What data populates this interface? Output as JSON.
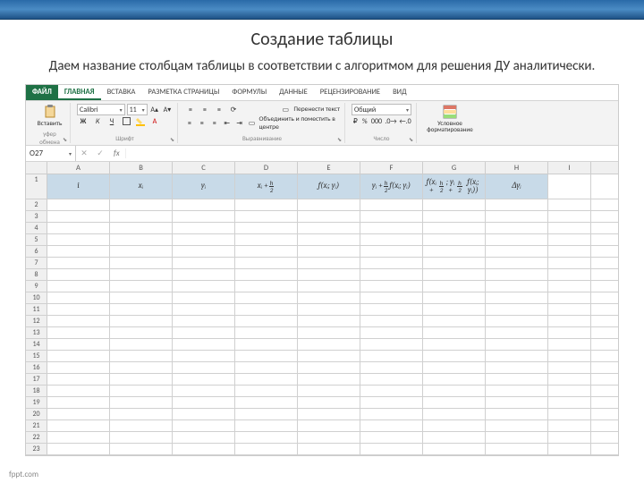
{
  "slide": {
    "title": "Создание таблицы",
    "subtitle": "Даем название столбцам таблицы в соответствии с алгоритмом для решения ДУ аналитически."
  },
  "tabs": {
    "file": "ФАЙЛ",
    "home": "ГЛАВНАЯ",
    "insert": "ВСТАВКА",
    "layout": "РАЗМЕТКА СТРАНИЦЫ",
    "formulas": "ФОРМУЛЫ",
    "data": "ДАННЫЕ",
    "review": "РЕЦЕНЗИРОВАНИЕ",
    "view": "ВИД"
  },
  "ribbon": {
    "paste": "Вставить",
    "clipboard": "уфер обмена",
    "font": "Шрифт",
    "font_name": "Calibri",
    "font_size": "11",
    "align": "Выравнивание",
    "wrap": "Перенести текст",
    "merge": "Объединить и поместить в центре",
    "number": "Число",
    "num_format": "Общий",
    "cond_format": "Условное форматирование"
  },
  "formula_bar": {
    "name_box": "O27",
    "fx": "fx"
  },
  "columns": [
    "A",
    "B",
    "C",
    "D",
    "E",
    "F",
    "G",
    "H",
    "I"
  ],
  "headers": {
    "A": "i",
    "B": "xᵢ",
    "C": "yᵢ",
    "D_pre": "xᵢ +",
    "E": "f(xᵢ; yᵢ)",
    "F_pre": "yᵢ +",
    "F_post": "f(xᵢ; yᵢ)",
    "G_pre": "f(xᵢ +",
    "G_mid": "; yᵢ +",
    "G_post": "f(xᵢ; yᵢ))",
    "H": "Δyᵢ"
  },
  "row_count": 23,
  "footer": "fppt.com"
}
